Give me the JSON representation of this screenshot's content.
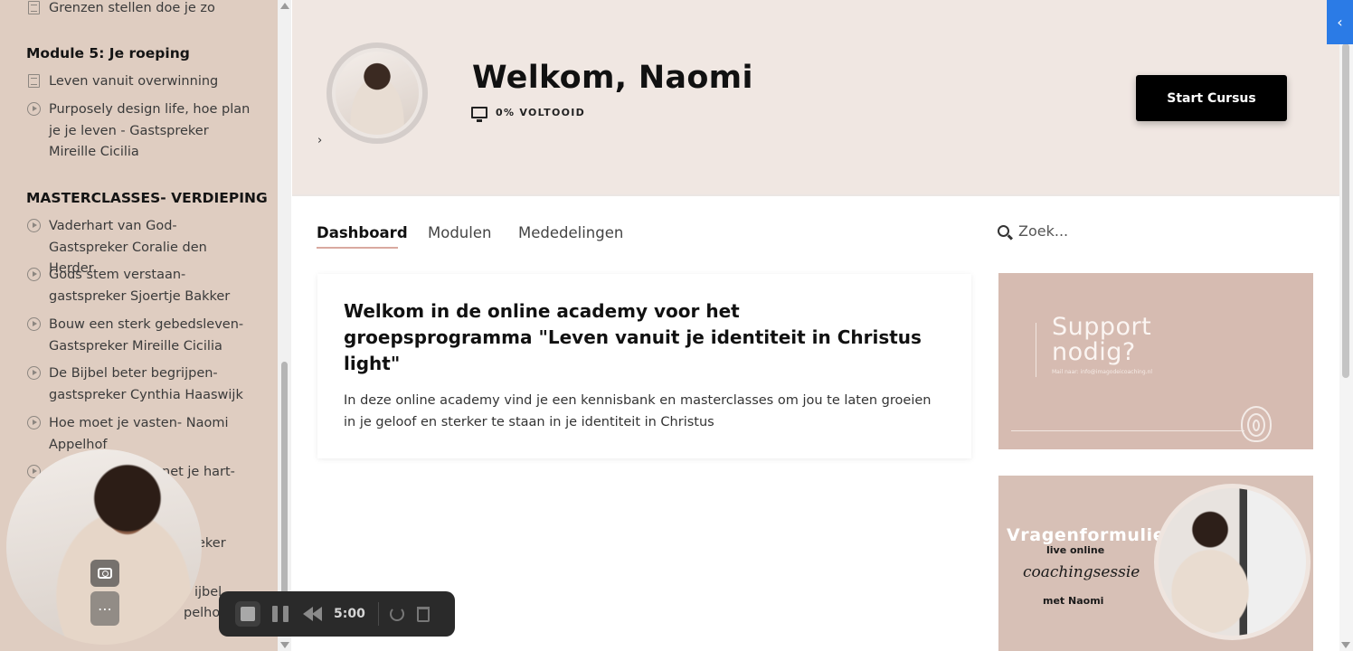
{
  "sidebar": {
    "items": [
      {
        "type": "doc",
        "label": "Grenzen stellen doe je zo"
      },
      {
        "type": "heading",
        "label": "Module 5: Je roeping"
      },
      {
        "type": "doc",
        "label": "Leven vanuit overwinning"
      },
      {
        "type": "video",
        "label": "Purposely design life, hoe plan je je leven - Gastspreker Mireille Cicilia"
      },
      {
        "type": "heading",
        "label": "MASTERCLASSES- VERDIEPING"
      },
      {
        "type": "video",
        "label": "Vaderhart van God- Gastspreker Coralie den Herder"
      },
      {
        "type": "video",
        "label": "Gods stem verstaan- gastspreker Sjoertje Bakker"
      },
      {
        "type": "video",
        "label": "Bouw een sterk gebedsleven- Gastspreker Mireille Cicilia"
      },
      {
        "type": "video",
        "label": "De Bijbel beter begrijpen- gastspreker Cynthia Haaswijk"
      },
      {
        "type": "video",
        "label": "Hoe moet je vasten- Naomi Appelhof"
      },
      {
        "type": "video",
        "label": "net je hart-"
      },
      {
        "type": "text",
        "label": "eker"
      },
      {
        "type": "text",
        "label": "ijbel"
      },
      {
        "type": "text",
        "label": "pelhof"
      }
    ]
  },
  "header": {
    "welcome": "Welkom, Naomi",
    "progress": "0% VOLTOOID",
    "start_button": "Start Cursus"
  },
  "tabs": [
    {
      "label": "Dashboard",
      "active": true
    },
    {
      "label": "Modulen",
      "active": false
    },
    {
      "label": "Mededelingen",
      "active": false
    }
  ],
  "search": {
    "placeholder": "Zoek..."
  },
  "card": {
    "title": "Welkom in de online academy voor het groepsprogramma \"Leven vanuit je identiteit in Christus light\"",
    "text": "In deze online academy vind je een kennisbank en masterclasses om jou te laten groeien in je geloof en sterker te staan in je identiteit in Christus"
  },
  "promo_support": {
    "title_line1": "Support",
    "title_line2": "nodig?",
    "mail": "Mail naar: info@imagodeicoaching.nl"
  },
  "promo_form": {
    "title": "Vragenformulier",
    "line1": "live online",
    "line2": "coachingsessie",
    "line3": "met Naomi"
  },
  "recorder": {
    "time": "5:00"
  },
  "colors": {
    "sidebar_bg": "#dfcdc1",
    "header_bg": "#f0e7e2",
    "tab_underline": "#d9a9a0",
    "collapse_button": "#2b7be6",
    "promo_bg": "#d6bbb1"
  },
  "icons": {
    "doc": "doc-icon",
    "video": "play-circle-icon",
    "search": "search-icon",
    "monitor": "monitor-icon"
  }
}
